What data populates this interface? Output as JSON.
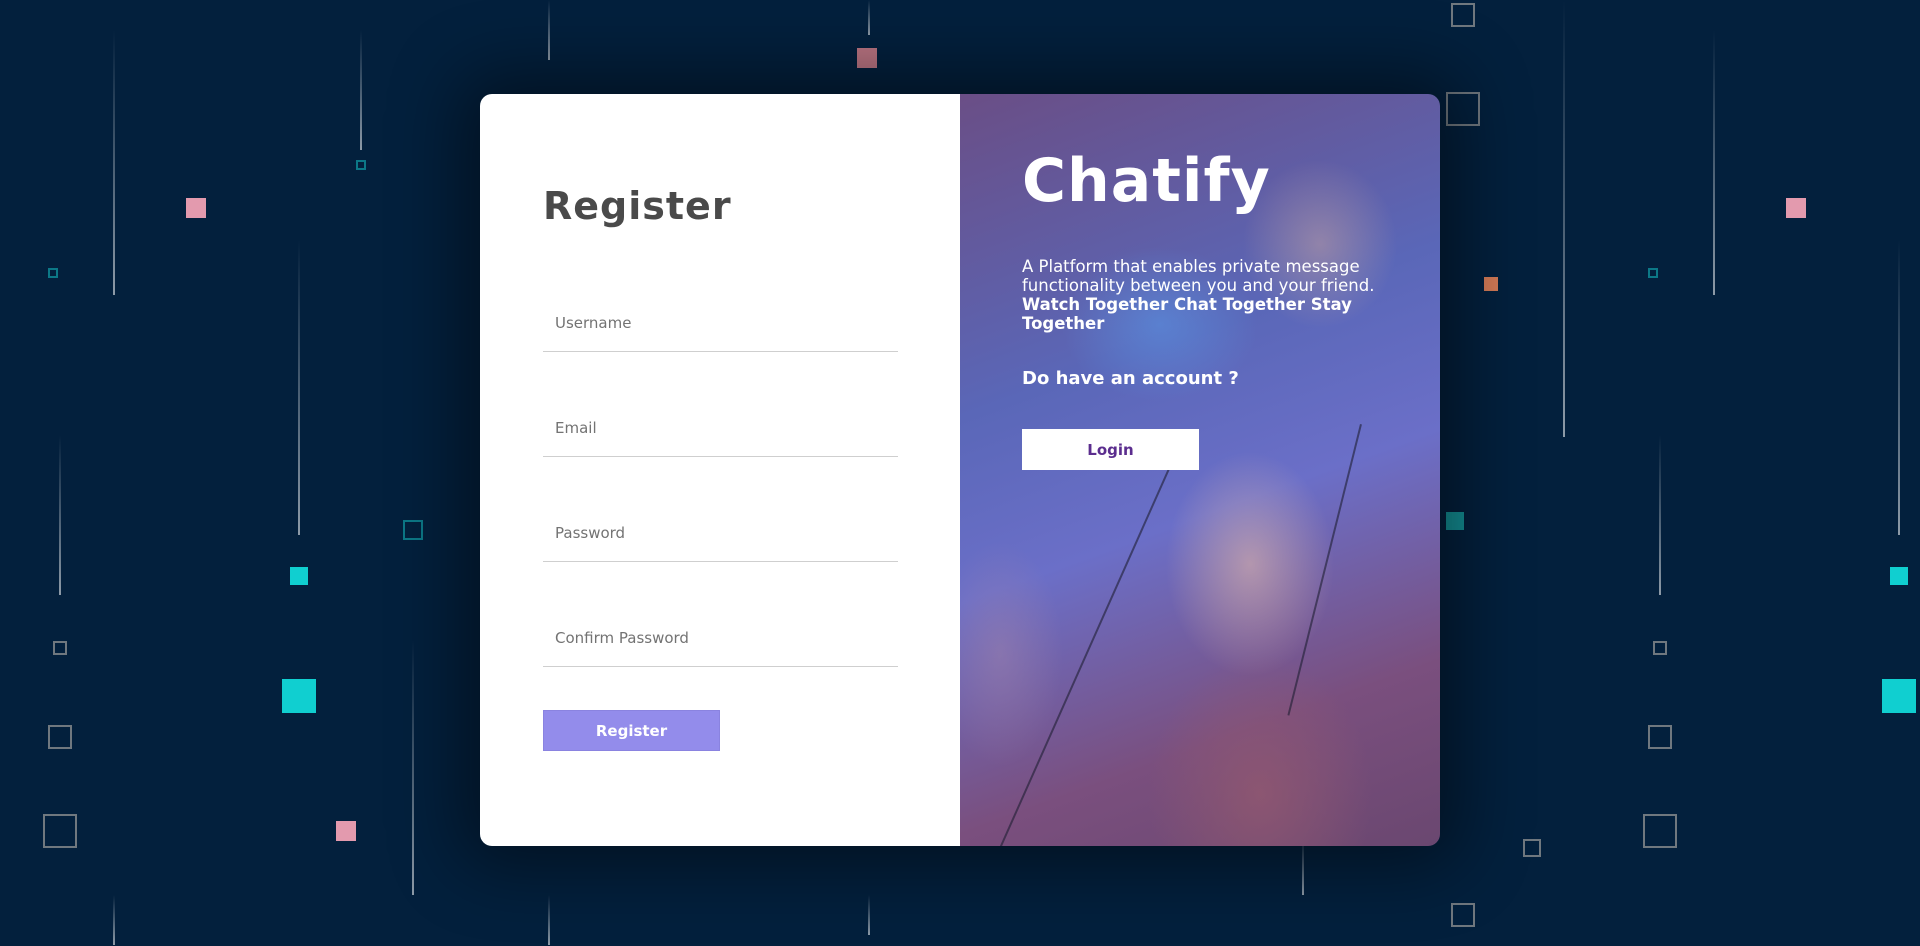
{
  "form": {
    "title": "Register",
    "username_placeholder": "Username",
    "email_placeholder": "Email",
    "password_placeholder": "Password",
    "confirm_password_placeholder": "Confirm Password",
    "register_button": "Register"
  },
  "info": {
    "brand": "Chatify",
    "tagline_plain": "A Platform that enables private message functionality between you and your friend. ",
    "tagline_bold": "Watch Together Chat Together Stay Together",
    "question": "Do have an account ?",
    "login_button": "Login"
  },
  "colors": {
    "background": "#03203d",
    "register_button": "#938ceb",
    "login_text": "#5b2d8e",
    "accent_pink": "#e39aae",
    "accent_teal": "#10cfd0"
  }
}
